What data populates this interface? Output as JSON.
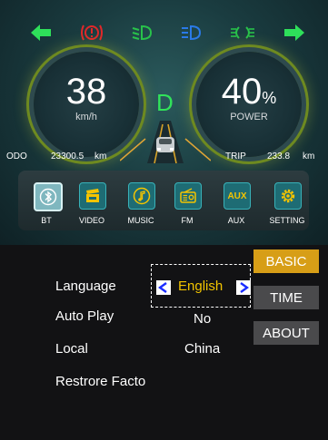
{
  "colors": {
    "left_arrow": "#2ee05a",
    "right_arrow": "#2ee05a",
    "warning": "#e0282a",
    "low_beam": "#28c24a",
    "high_beam": "#2a7ae8",
    "position_light": "#28c24a",
    "gear": "#31e35a",
    "active_tab": "#d79e17",
    "accent_value": "#f2c400"
  },
  "indicators": {
    "left_arrow": "arrow-left-icon",
    "warning": "brake-warning-icon",
    "low_beam": "low-beam-icon",
    "high_beam": "high-beam-icon",
    "position_light": "position-light-icon",
    "right_arrow": "arrow-right-icon"
  },
  "speed_gauge": {
    "value": "38",
    "unit": "km/h"
  },
  "power_gauge": {
    "value": "40",
    "suffix": "%",
    "unit": "POWER"
  },
  "gear": "D",
  "odo": {
    "label": "ODO",
    "value": "23300.5",
    "unit": "km"
  },
  "trip": {
    "label": "TRIP",
    "value": "233.8",
    "unit": "km"
  },
  "media_bar": [
    {
      "label": "BT",
      "icon": "bluetooth-icon"
    },
    {
      "label": "VIDEO",
      "icon": "video-clapper-icon"
    },
    {
      "label": "MUSIC",
      "icon": "music-note-icon"
    },
    {
      "label": "FM",
      "icon": "radio-icon"
    },
    {
      "label": "AUX",
      "icon": "aux-icon",
      "icon_text": "AUX"
    },
    {
      "label": "SETTING",
      "icon": "gear-icon"
    }
  ],
  "settings": {
    "rows": [
      {
        "label": "Language",
        "value": "English"
      },
      {
        "label": "Auto Play",
        "value": "No"
      },
      {
        "label": "Local",
        "value": "China"
      },
      {
        "label": "Restrore Facto",
        "value": ""
      }
    ]
  },
  "side_tabs": [
    {
      "label": "BASIC",
      "active": true
    },
    {
      "label": "TIME",
      "active": false
    },
    {
      "label": "ABOUT",
      "active": false
    }
  ]
}
